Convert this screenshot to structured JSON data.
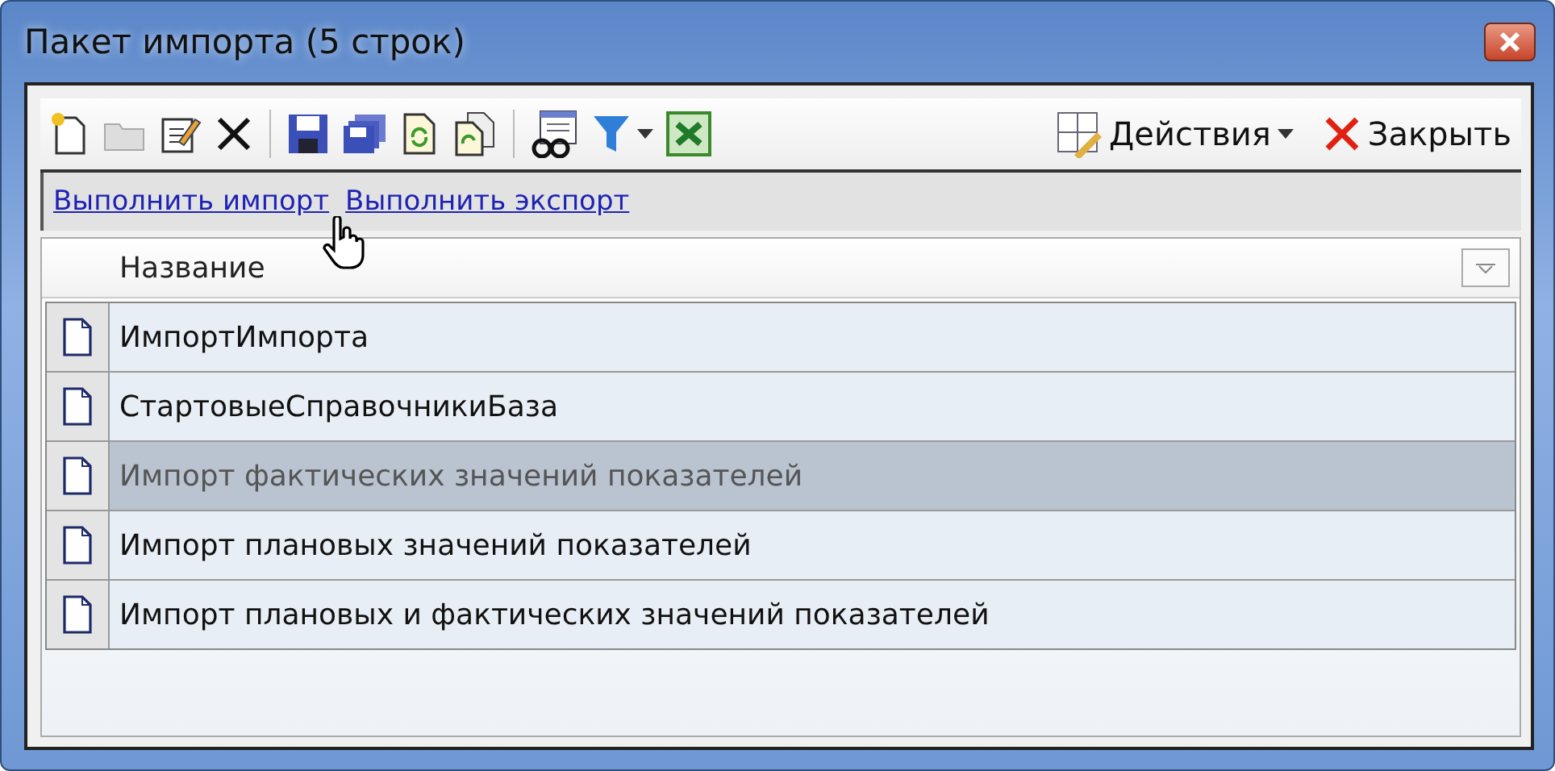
{
  "window": {
    "title": "Пакет импорта (5 строк)"
  },
  "toolbar": {
    "actions_label": "Действия",
    "close_label": "Закрыть"
  },
  "links": [
    {
      "label": "Выполнить импорт"
    },
    {
      "label": "Выполнить экспорт"
    }
  ],
  "table": {
    "columns": [
      "Название"
    ],
    "rows": [
      {
        "name": "ИмпортИмпорта",
        "selected": false
      },
      {
        "name": "СтартовыеСправочникиБаза",
        "selected": false
      },
      {
        "name": "Импорт фактических значений показателей",
        "selected": true
      },
      {
        "name": "Импорт плановых значений показателей",
        "selected": false
      },
      {
        "name": "Импорт плановых и фактических значений показателей",
        "selected": false
      }
    ]
  }
}
